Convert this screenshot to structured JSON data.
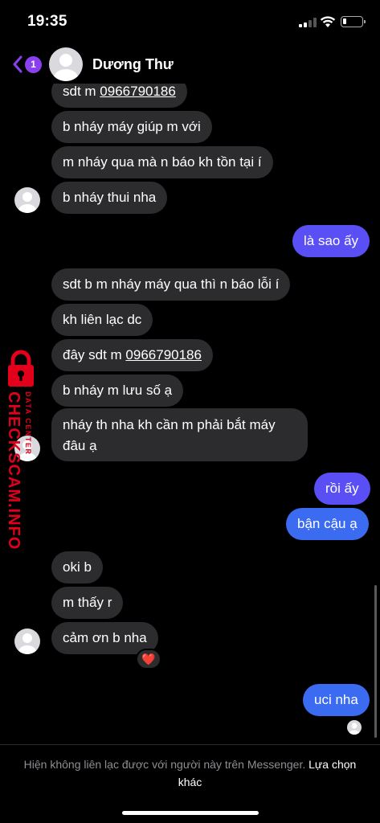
{
  "status_bar": {
    "time": "19:35"
  },
  "header": {
    "back_badge": "1",
    "contact_name": "Dương Thư"
  },
  "messages": {
    "m1_prefix": "sdt m ",
    "m1_phone": "0966790186",
    "m2": "b nháy máy giúp m với",
    "m3": "m nháy qua mà n báo kh tồn tại í",
    "m4": "b nháy thui nha",
    "m5": "là sao ấy",
    "m6": "sdt b m nháy máy qua thì n báo lỗi í",
    "m7": "kh liên lạc dc",
    "m8_prefix": "đây sdt m ",
    "m8_phone": "0966790186",
    "m9": "b nháy m lưu số ạ",
    "m10_line1": "nháy th nha kh cần m phải bắt máy",
    "m10_line2": "đâu ạ",
    "m11": "rồi ấy",
    "m12": "bận cậu ạ",
    "m13": "oki b",
    "m14": "m thấy r",
    "m15": "cảm ơn b nha",
    "m15_reaction": "❤️",
    "m16": "uci nha"
  },
  "watermark": {
    "main": "CHECKSCAM.INFO",
    "sub": "DATA CENTER"
  },
  "footer": {
    "notice": "Hiện không liên lạc được với người này trên Messenger.",
    "action": "Lựa chọn khác"
  },
  "colors": {
    "outgoing_bubble": "#5a4ff5",
    "incoming_bubble": "#2c2c2e",
    "badge": "#8a3ff0",
    "watermark": "#e2001a"
  }
}
